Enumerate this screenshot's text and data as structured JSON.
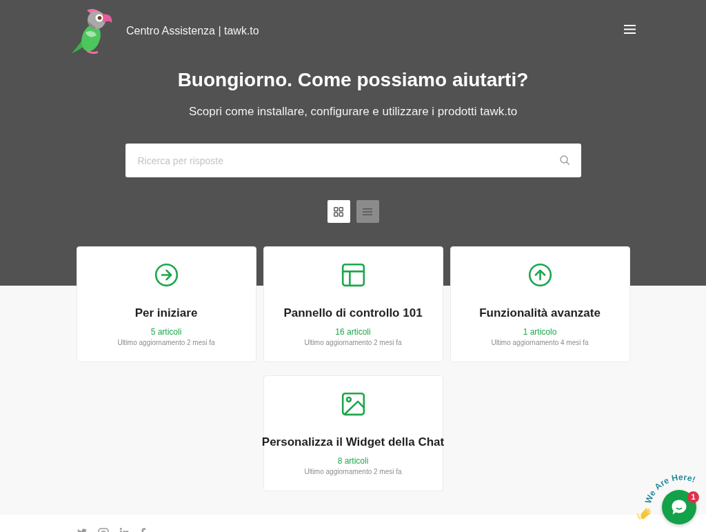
{
  "header": {
    "site_title": "Centro Assistenza | tawk.to"
  },
  "hero": {
    "heading": "Buongiorno. Come possiamo aiutarti?",
    "subheading": "Scopri come installare, configurare e utilizzare i prodotti tawk.to",
    "search": {
      "placeholder": "Ricerca per risposte"
    },
    "view_toggle": [
      {
        "kind": "grid",
        "selected": true
      },
      {
        "kind": "list",
        "selected": false
      }
    ]
  },
  "categories": [
    {
      "kind": "arrow-right",
      "title": "Per iniziare",
      "count": "5 articoli",
      "updated": "Ultimo aggiornamento 2 mesi fa"
    },
    {
      "kind": "layout",
      "title": "Pannello di controllo 101",
      "count": "16 articoli",
      "updated": "Ultimo aggiornamento 2 mesi fa"
    },
    {
      "kind": "arrow-up",
      "title": "Funzionalità avanzate",
      "count": "1 articolo",
      "updated": "Ultimo aggiornamento 4 mesi fa"
    },
    {
      "kind": "image",
      "title": "Personalizza il Widget della Chat",
      "count": "8 articoli",
      "updated": "Ultimo aggiornamento 2 mesi fa"
    }
  ],
  "footer": {
    "social": [
      {
        "kind": "twitter"
      },
      {
        "kind": "instagram"
      },
      {
        "kind": "linkedin"
      },
      {
        "kind": "facebook"
      }
    ]
  },
  "chat_widget": {
    "label_words": [
      "We",
      "Are",
      "Here!"
    ],
    "unread": "1"
  }
}
